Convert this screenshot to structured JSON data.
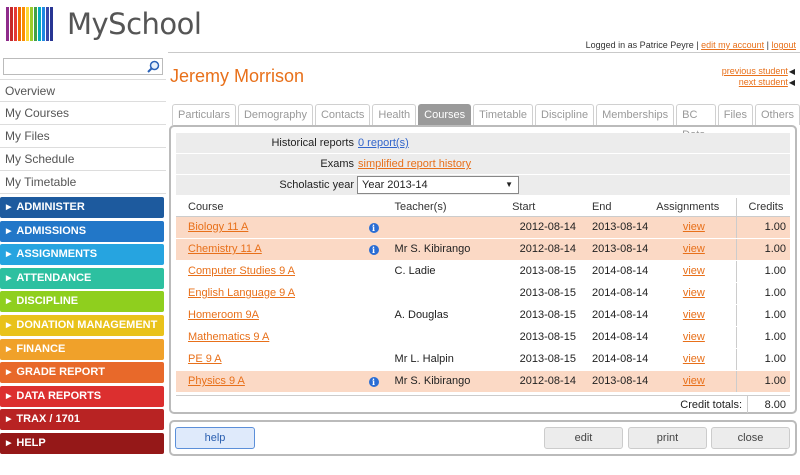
{
  "app": {
    "title": "MySchool"
  },
  "logo_colors": [
    "#8e2b8b",
    "#c62828",
    "#e53935",
    "#ef6c00",
    "#fb8c00",
    "#fdd835",
    "#9ccc2b",
    "#43a047",
    "#00acc1",
    "#1e88e5",
    "#3949ab",
    "#283593"
  ],
  "userbar": {
    "logged_in_text": "Logged in as Patrice Peyre |",
    "edit_account": "edit my account",
    "separator": "|",
    "logout": "logout"
  },
  "search": {
    "placeholder": "",
    "value": ""
  },
  "sidebar": {
    "items": [
      {
        "label": "Overview"
      },
      {
        "label": "My Courses"
      },
      {
        "label": "My Files"
      },
      {
        "label": "My Schedule"
      },
      {
        "label": "My Timetable"
      }
    ],
    "modules": [
      {
        "label": "ADMINISTER",
        "color": "#1d5a9e"
      },
      {
        "label": "ADMISSIONS",
        "color": "#2277c8"
      },
      {
        "label": "ASSIGNMENTS",
        "color": "#26a4e0"
      },
      {
        "label": "ATTENDANCE",
        "color": "#2dc0a0"
      },
      {
        "label": "DISCIPLINE",
        "color": "#8fcf1e"
      },
      {
        "label": "DONATION MANAGEMENT",
        "color": "#e9c21a"
      },
      {
        "label": "FINANCE",
        "color": "#f0a12a"
      },
      {
        "label": "GRADE REPORT",
        "color": "#e8692a"
      },
      {
        "label": "DATA REPORTS",
        "color": "#dc2f2f"
      },
      {
        "label": "TRAX / 1701",
        "color": "#b82323"
      },
      {
        "label": "HELP",
        "color": "#951818"
      }
    ]
  },
  "student": {
    "name": "Jeremy Morrison",
    "previous": "previous student",
    "next": "next student"
  },
  "tabs": [
    {
      "label": "Particulars",
      "active": false
    },
    {
      "label": "Demography",
      "active": false
    },
    {
      "label": "Contacts",
      "active": false
    },
    {
      "label": "Health",
      "active": false
    },
    {
      "label": "Courses",
      "active": true
    },
    {
      "label": "Timetable",
      "active": false
    },
    {
      "label": "Discipline",
      "active": false
    },
    {
      "label": "Memberships",
      "active": false
    },
    {
      "label": "BC Data",
      "active": false
    },
    {
      "label": "Files",
      "active": false
    },
    {
      "label": "Others",
      "active": false
    }
  ],
  "info": {
    "historical_label": "Historical reports",
    "historical_value": "0 report(s)",
    "exams_label": "Exams",
    "exams_value": "simplified report history",
    "year_label": "Scholastic year",
    "year_value": "Year 2013-14"
  },
  "table": {
    "headers": {
      "course": "Course",
      "teachers": "Teacher(s)",
      "start": "Start",
      "end": "End",
      "assignments": "Assignments",
      "credits": "Credits"
    },
    "rows": [
      {
        "course": "Biology 11 A",
        "info": true,
        "teacher": "",
        "start": "2012-08-14",
        "end": "2013-08-14",
        "assign": "view",
        "credits": "1.00",
        "highlight": true
      },
      {
        "course": "Chemistry 11 A",
        "info": true,
        "teacher": "Mr S. Kibirango",
        "start": "2012-08-14",
        "end": "2013-08-14",
        "assign": "view",
        "credits": "1.00",
        "highlight": true
      },
      {
        "course": "Computer Studies 9 A",
        "info": false,
        "teacher": "C. Ladie",
        "start": "2013-08-15",
        "end": "2014-08-14",
        "assign": "view",
        "credits": "1.00",
        "highlight": false
      },
      {
        "course": "English Language 9 A",
        "info": false,
        "teacher": "",
        "start": "2013-08-15",
        "end": "2014-08-14",
        "assign": "view",
        "credits": "1.00",
        "highlight": false
      },
      {
        "course": "Homeroom 9A",
        "info": false,
        "teacher": "A. Douglas",
        "start": "2013-08-15",
        "end": "2014-08-14",
        "assign": "view",
        "credits": "1.00",
        "highlight": false
      },
      {
        "course": "Mathematics 9 A",
        "info": false,
        "teacher": "",
        "start": "2013-08-15",
        "end": "2014-08-14",
        "assign": "view",
        "credits": "1.00",
        "highlight": false
      },
      {
        "course": "PE 9 A",
        "info": false,
        "teacher": "Mr L. Halpin",
        "start": "2013-08-15",
        "end": "2014-08-14",
        "assign": "view",
        "credits": "1.00",
        "highlight": false
      },
      {
        "course": "Physics 9 A",
        "info": true,
        "teacher": "Mr S. Kibirango",
        "start": "2012-08-14",
        "end": "2013-08-14",
        "assign": "view",
        "credits": "1.00",
        "highlight": true
      }
    ],
    "total_label": "Credit totals:",
    "total_value": "8.00"
  },
  "footer": {
    "help": "help",
    "edit": "edit",
    "print": "print",
    "close": "close"
  }
}
